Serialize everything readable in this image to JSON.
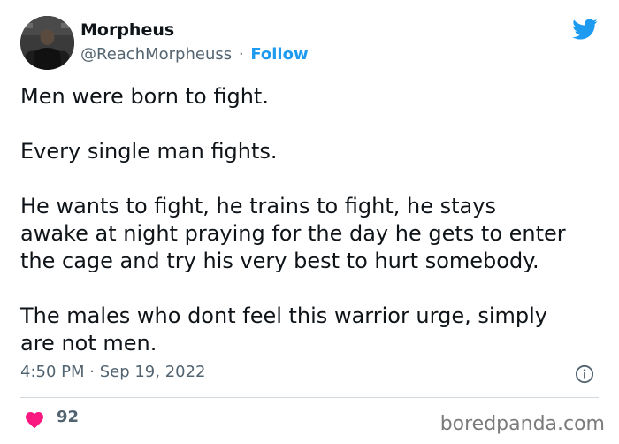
{
  "author": {
    "display_name": "Morpheus",
    "handle": "@ReachMorpheuss",
    "separator": "·",
    "follow_label": "Follow"
  },
  "tweet": {
    "paragraphs": [
      [
        "Men were born to fight."
      ],
      [
        "Every single man fights."
      ],
      [
        "He wants to fight, he trains to fight, he stays",
        "awake at night praying for the day he gets to enter",
        "the cage and try his very best to hurt somebody."
      ],
      [
        "The males who dont feel this warrior urge, simply",
        "are not men."
      ]
    ],
    "timestamp": "4:50 PM · Sep 19, 2022"
  },
  "engagement": {
    "like_count": "92"
  },
  "watermark": "boredpanda.com",
  "icons": {
    "brand": "twitter-bird-icon",
    "info": "info-icon",
    "like": "heart-icon"
  },
  "colors": {
    "brand_blue": "#1d9bf0",
    "heart_red": "#f91880",
    "secondary_text": "#536471",
    "primary_text": "#0f1419",
    "divider": "#cfd9de"
  }
}
